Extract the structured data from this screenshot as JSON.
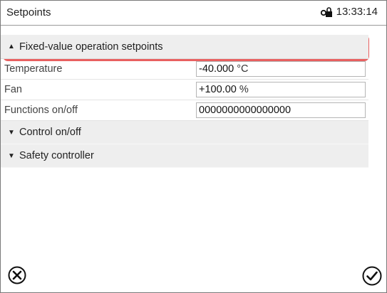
{
  "header": {
    "title": "Setpoints",
    "time": "13:33:14",
    "lock_icon": "lock-icon"
  },
  "section": {
    "label": "Fixed-value operation setpoints",
    "arrow_icon": "triangle-up-icon",
    "highlight_color": "#e86060"
  },
  "rows": [
    {
      "label": "Temperature",
      "value": "-40.000",
      "unit": "°C"
    },
    {
      "label": "Fan",
      "value": "+100.00",
      "unit": "%"
    },
    {
      "label": "Functions on/off",
      "value": "0000000000000000",
      "unit": ""
    }
  ],
  "collapsed_sections": [
    {
      "label": "Control on/off",
      "arrow_icon": "triangle-down-icon"
    },
    {
      "label": "Safety controller",
      "arrow_icon": "triangle-down-icon"
    }
  ],
  "footer": {
    "cancel_icon": "cancel-icon",
    "confirm_icon": "confirm-check-icon"
  }
}
